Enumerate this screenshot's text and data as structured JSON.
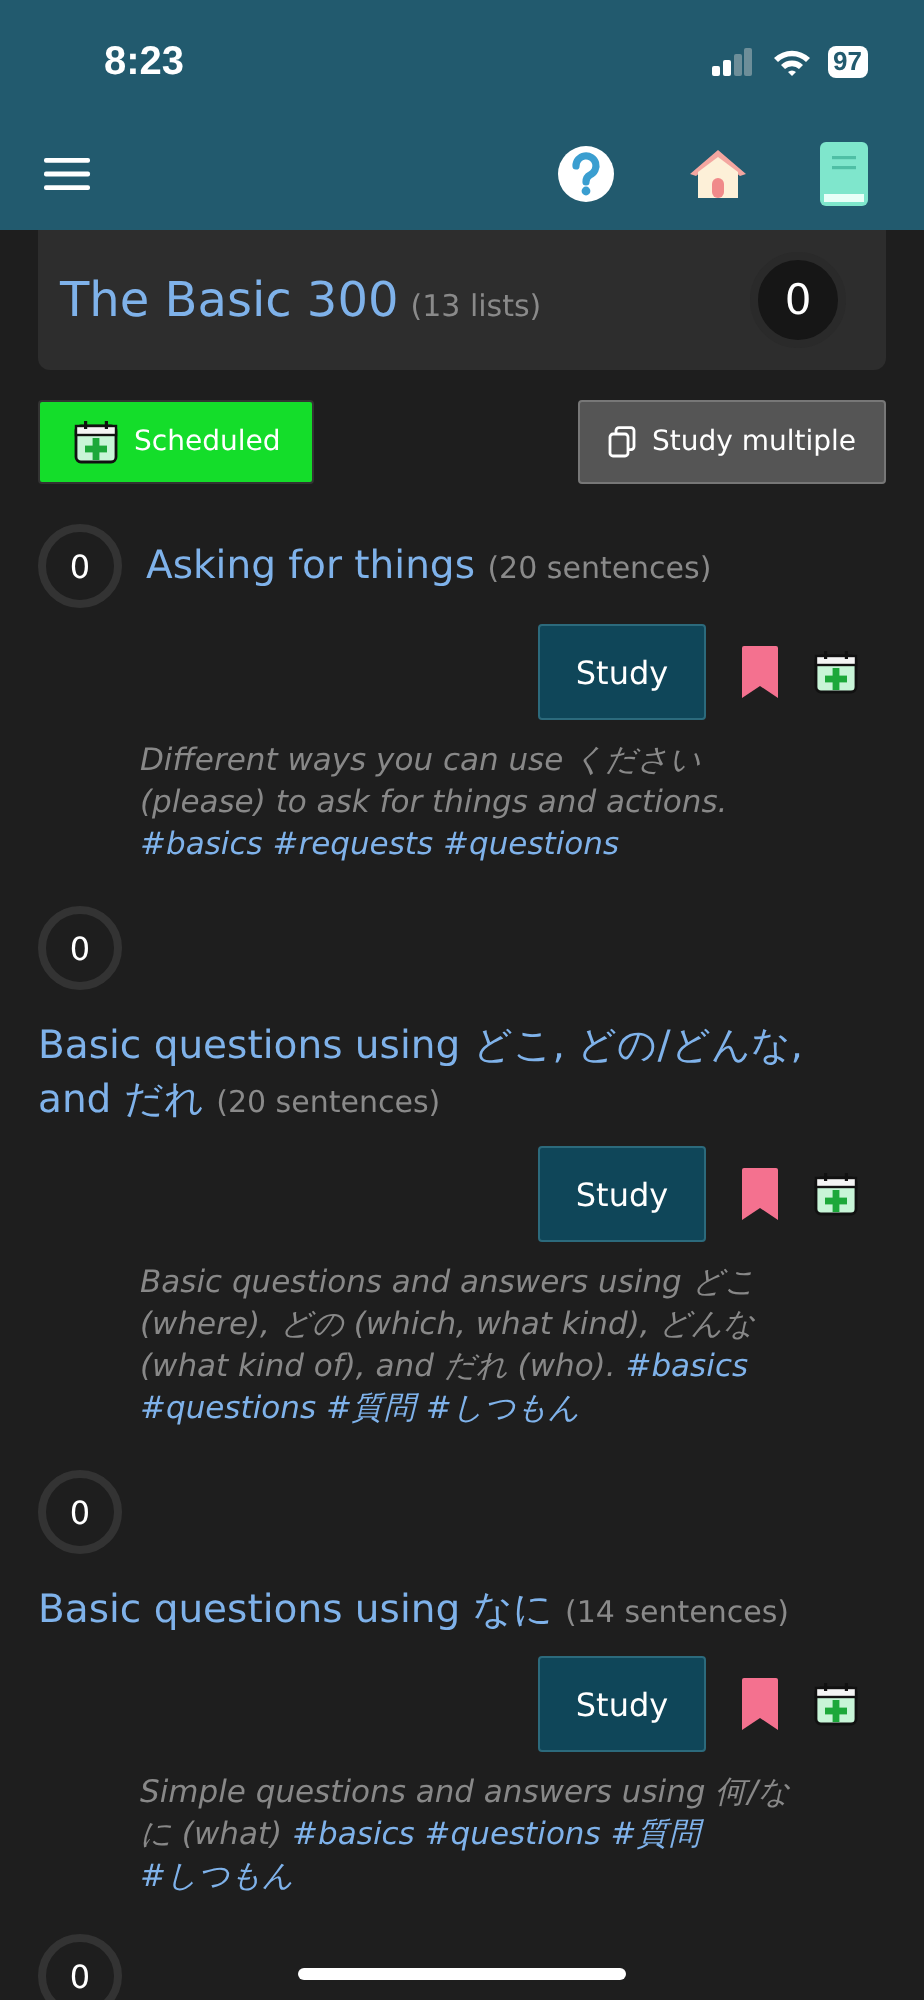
{
  "status_bar": {
    "time": "8:23",
    "battery": "97"
  },
  "collection": {
    "title": "The Basic 300",
    "count": "(13 lists)",
    "counter": "0"
  },
  "actions": [
    {
      "kind": "scheduled",
      "label": "Scheduled"
    },
    {
      "kind": "multiple",
      "label": "Study multiple"
    }
  ],
  "lists": [
    {
      "kind": "inline",
      "counter": "0",
      "title": "Asking for things",
      "count": "(20 sentences)",
      "button": "Study",
      "description": "Different ways you can use ください (please) to ask for things and actions.",
      "tags": [
        "#basics",
        "#requests",
        "#questions"
      ]
    },
    {
      "kind": "stacked",
      "counter": "0",
      "title": "Basic questions using どこ, どの/どんな, and だれ",
      "count": "(20 sentences)",
      "button": "Study",
      "description": "Basic questions and answers using どこ (where), どの (which, what kind), どんな (what kind of), and だれ (who).",
      "tags": [
        "#basics",
        "#questions",
        "#質問",
        "#しつもん"
      ]
    },
    {
      "kind": "stacked",
      "counter": "0",
      "title": "Basic questions using なに",
      "count": "(14 sentences)",
      "button": "Study",
      "description": "Simple questions and answers using 何/なに (what)",
      "tags": [
        "#basics",
        "#questions",
        "#質問",
        "#しつもん"
      ]
    },
    {
      "kind": "counter-only",
      "counter": "0"
    }
  ]
}
